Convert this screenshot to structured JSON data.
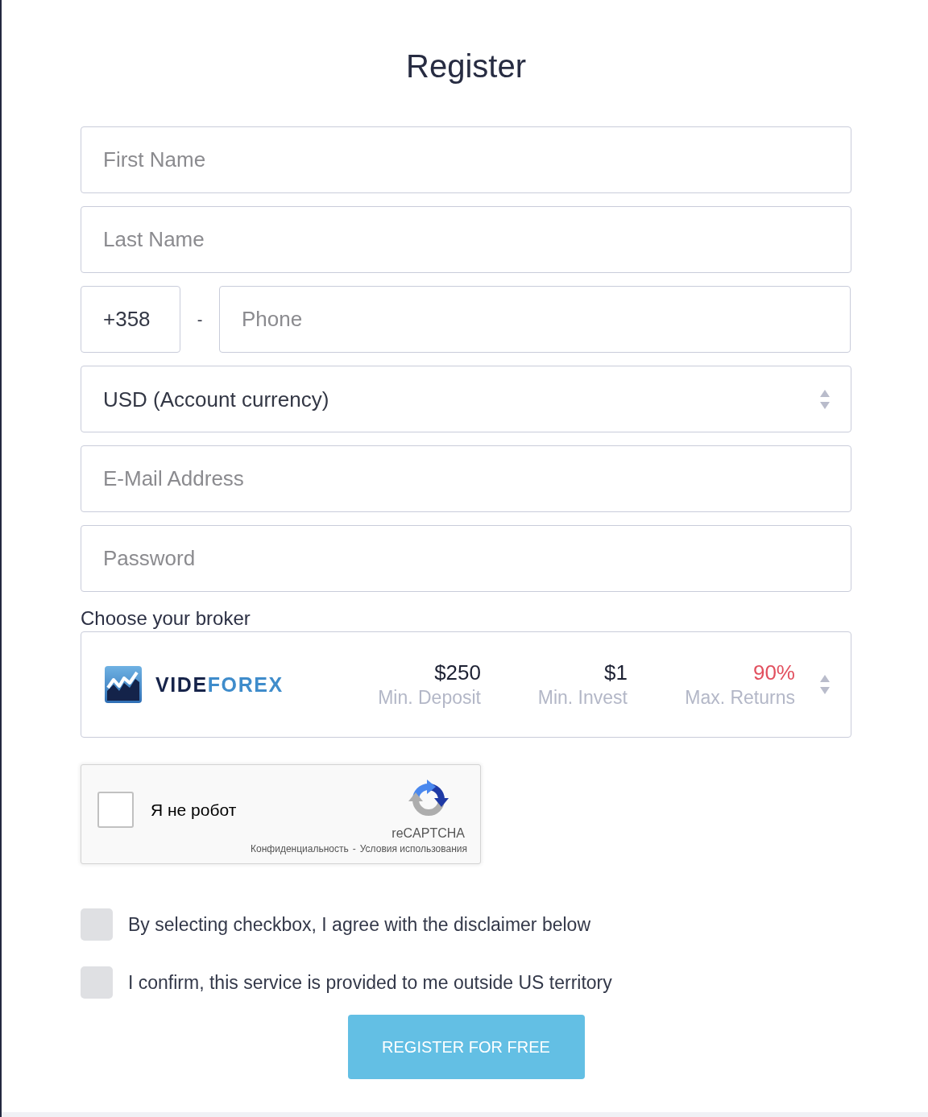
{
  "title": "Register",
  "fields": [
    {
      "kind": "text",
      "placeholder": "First Name"
    },
    {
      "kind": "text",
      "placeholder": "Last Name"
    },
    {
      "kind": "phone",
      "code": "+358",
      "separator": "-",
      "placeholder": "Phone"
    },
    {
      "kind": "select",
      "value": "USD (Account currency)"
    },
    {
      "kind": "text",
      "placeholder": "E-Mail Address"
    },
    {
      "kind": "password",
      "placeholder": "Password"
    }
  ],
  "broker": {
    "label": "Choose your broker",
    "logo": [
      {
        "text": "VIDE",
        "color": "#17244a"
      },
      {
        "text": "FOREX",
        "color": "#3f8ccb"
      }
    ],
    "stats": [
      {
        "value": "$250",
        "label": "Min. Deposit",
        "highlight": false
      },
      {
        "value": "$1",
        "label": "Min. Invest",
        "highlight": false
      },
      {
        "value": "90%",
        "label": "Max. Returns",
        "highlight": true
      }
    ]
  },
  "recaptcha": {
    "checked": false,
    "label": "Я не робот",
    "brand": "reCAPTCHA",
    "links": [
      "Конфиденциальность",
      "Условия использования"
    ],
    "separator": "-"
  },
  "agreements": [
    {
      "checked": false,
      "label": "By selecting checkbox, I agree with the disclaimer below"
    },
    {
      "checked": false,
      "label": "I confirm, this service is provided to me outside US territory"
    }
  ],
  "submit": {
    "label": "REGISTER FOR FREE"
  }
}
